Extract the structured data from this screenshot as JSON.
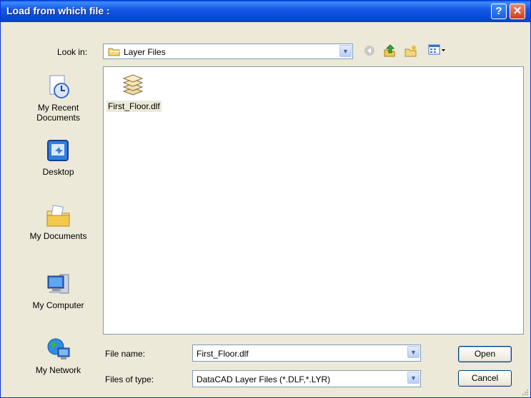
{
  "window": {
    "title": "Load from which file :"
  },
  "titlebar": {
    "help_glyph": "?",
    "close_glyph": "✕"
  },
  "lookin": {
    "label": "Look in:",
    "value": "Layer Files"
  },
  "toolbar": {
    "icons": [
      "back-icon",
      "up-folder-icon",
      "new-folder-icon",
      "view-menu-icon"
    ]
  },
  "places": [
    {
      "label_line1": "My Recent",
      "label_line2": "Documents"
    },
    {
      "label_line1": "Desktop",
      "label_line2": ""
    },
    {
      "label_line1": "My Documents",
      "label_line2": ""
    },
    {
      "label_line1": "My Computer",
      "label_line2": ""
    },
    {
      "label_line1": "My Network",
      "label_line2": ""
    }
  ],
  "files": [
    {
      "name": "First_Floor.dlf"
    }
  ],
  "filename": {
    "label": "File name:",
    "value": "First_Floor.dlf"
  },
  "filetype": {
    "label": "Files of type:",
    "value": "DataCAD Layer Files (*.DLF,*.LYR)"
  },
  "buttons": {
    "open": "Open",
    "cancel": "Cancel"
  },
  "colors": {
    "titlebar": "#0a5fe6",
    "dialog_bg": "#ece9d8",
    "field_border": "#7f9db9"
  }
}
